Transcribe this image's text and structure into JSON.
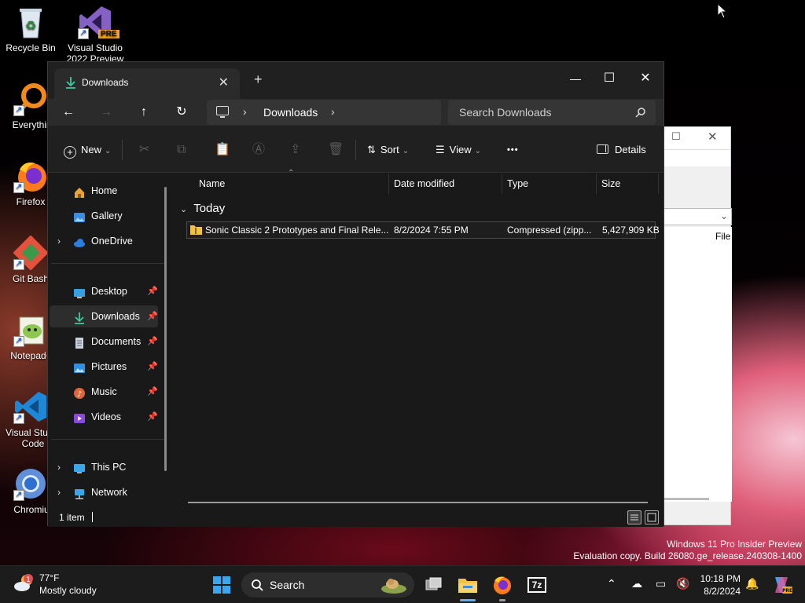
{
  "desktop": {
    "icons": [
      {
        "name": "Recycle Bin"
      },
      {
        "name": "Visual Studio 2022 Preview"
      },
      {
        "name": "Everything"
      },
      {
        "name": "Firefox"
      },
      {
        "name": "Git Bash"
      },
      {
        "name": "Notepad++"
      },
      {
        "name": "Visual Studio Code"
      },
      {
        "name": "Chromium"
      }
    ],
    "badge_pre": "PRE"
  },
  "window": {
    "tab_title": "Downloads",
    "new_tab": "+",
    "controls": {
      "minimize": "—",
      "maximize": "☐",
      "close": "✕"
    }
  },
  "nav": {
    "back": "←",
    "forward": "→",
    "up": "↑",
    "refresh": "↻",
    "breadcrumb": "Downloads",
    "search_placeholder": "Search Downloads"
  },
  "toolbar": {
    "new_label": "New",
    "sort_label": "Sort",
    "view_label": "View",
    "more_label": "•••",
    "details_label": "Details"
  },
  "sidebar": {
    "items": [
      {
        "label": "Home"
      },
      {
        "label": "Gallery"
      },
      {
        "label": "OneDrive"
      },
      {
        "label": "Desktop"
      },
      {
        "label": "Downloads"
      },
      {
        "label": "Documents"
      },
      {
        "label": "Pictures"
      },
      {
        "label": "Music"
      },
      {
        "label": "Videos"
      },
      {
        "label": "This PC"
      },
      {
        "label": "Network"
      }
    ]
  },
  "columns": {
    "name": "Name",
    "date": "Date modified",
    "type": "Type",
    "size": "Size"
  },
  "groups": [
    {
      "label": "Today",
      "files": [
        {
          "name": "Sonic Classic 2 Prototypes and Final Rele...",
          "date": "8/2/2024 7:55 PM",
          "type": "Compressed (zipp...",
          "size": "5,427,909 KB"
        }
      ]
    }
  ],
  "status": {
    "count": "1 item"
  },
  "watermark": {
    "line1": "Windows 11 Pro Insider Preview",
    "line2": "Evaluation copy. Build 26080.ge_release.240308-1400"
  },
  "taskbar": {
    "temperature": "77°F",
    "condition": "Mostly cloudy",
    "search_label": "Search",
    "time": "10:18 PM",
    "date": "8/2/2024",
    "app_7z": "7z"
  },
  "bgwindow": {
    "file_label": "File"
  }
}
